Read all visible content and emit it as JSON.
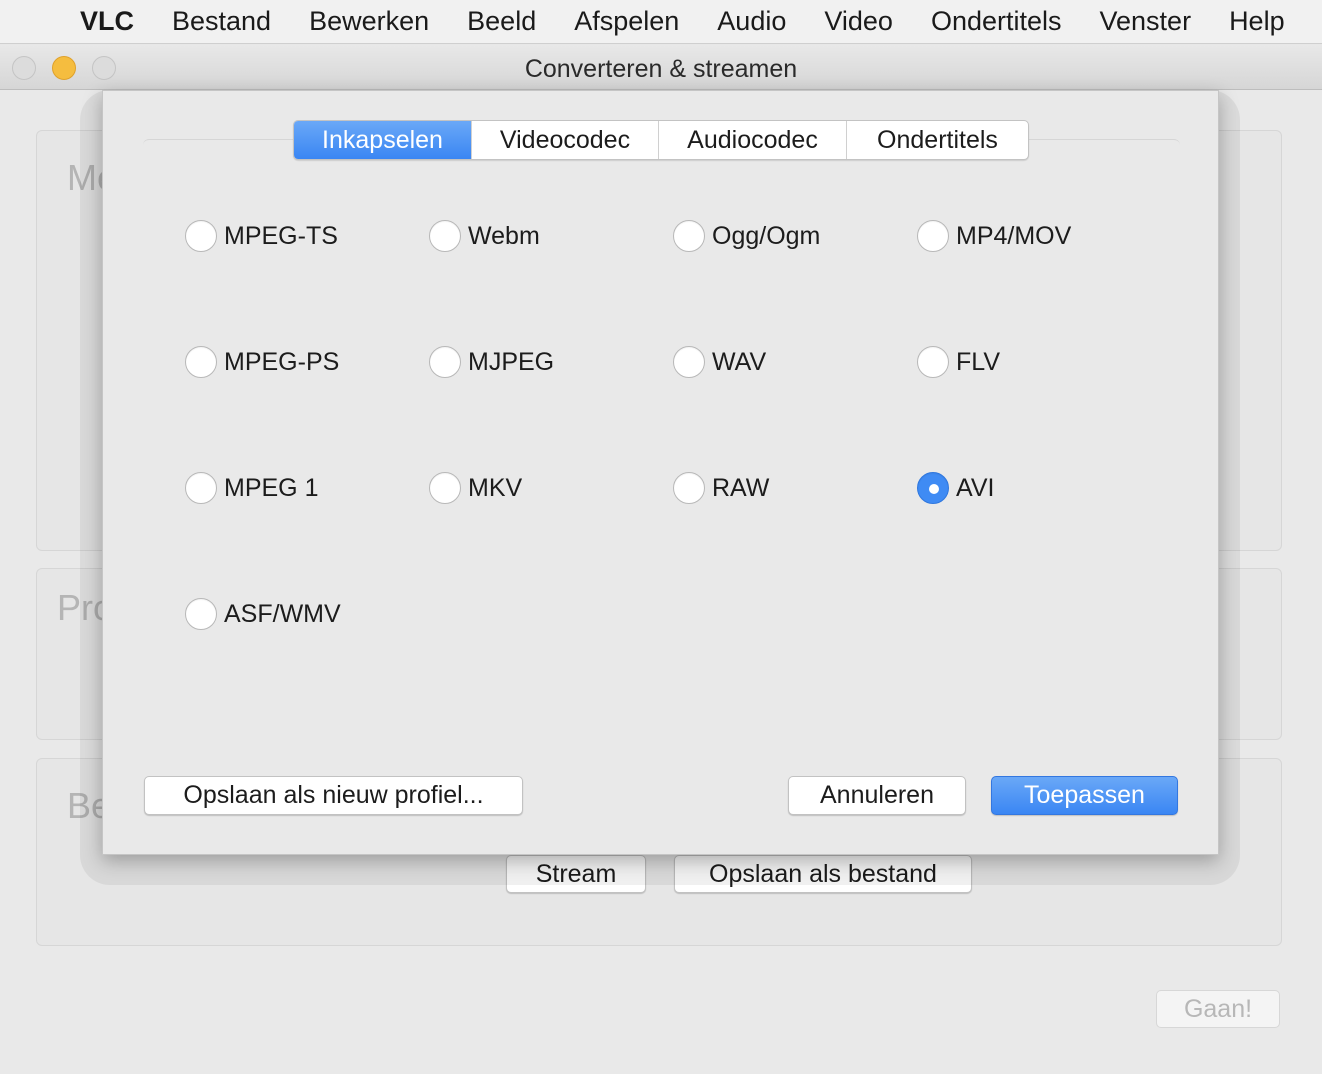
{
  "menubar": {
    "app": "VLC",
    "items": [
      "Bestand",
      "Bewerken",
      "Beeld",
      "Afspelen",
      "Audio",
      "Video",
      "Ondertitels",
      "Venster",
      "Help"
    ]
  },
  "window": {
    "title": "Converteren & streamen",
    "bg_labels": {
      "media": "Media",
      "profile": "Profiel",
      "destination": "Bestemming"
    },
    "stream_button": "Stream",
    "save_file_button": "Opslaan als bestand",
    "go_button": "Gaan!"
  },
  "dialog": {
    "tabs": [
      {
        "label": "Inkapselen",
        "active": true
      },
      {
        "label": "Videocodec",
        "active": false
      },
      {
        "label": "Audiocodec",
        "active": false
      },
      {
        "label": "Ondertitels",
        "active": false
      }
    ],
    "formats": [
      {
        "label": "MPEG-TS",
        "checked": false
      },
      {
        "label": "Webm",
        "checked": false
      },
      {
        "label": "Ogg/Ogm",
        "checked": false
      },
      {
        "label": "MP4/MOV",
        "checked": false
      },
      {
        "label": "MPEG-PS",
        "checked": false
      },
      {
        "label": "MJPEG",
        "checked": false
      },
      {
        "label": "WAV",
        "checked": false
      },
      {
        "label": "FLV",
        "checked": false
      },
      {
        "label": "MPEG 1",
        "checked": false
      },
      {
        "label": "MKV",
        "checked": false
      },
      {
        "label": "RAW",
        "checked": false
      },
      {
        "label": "AVI",
        "checked": true
      },
      {
        "label": "ASF/WMV",
        "checked": false
      }
    ],
    "save_profile_button": "Opslaan als nieuw profiel...",
    "cancel_button": "Annuleren",
    "apply_button": "Toepassen"
  },
  "colors": {
    "accent": "#3a86f3",
    "menubar_bg": "#f1f1f1",
    "window_bg": "#e9e9e9",
    "minimize": "#f5bd3f"
  }
}
